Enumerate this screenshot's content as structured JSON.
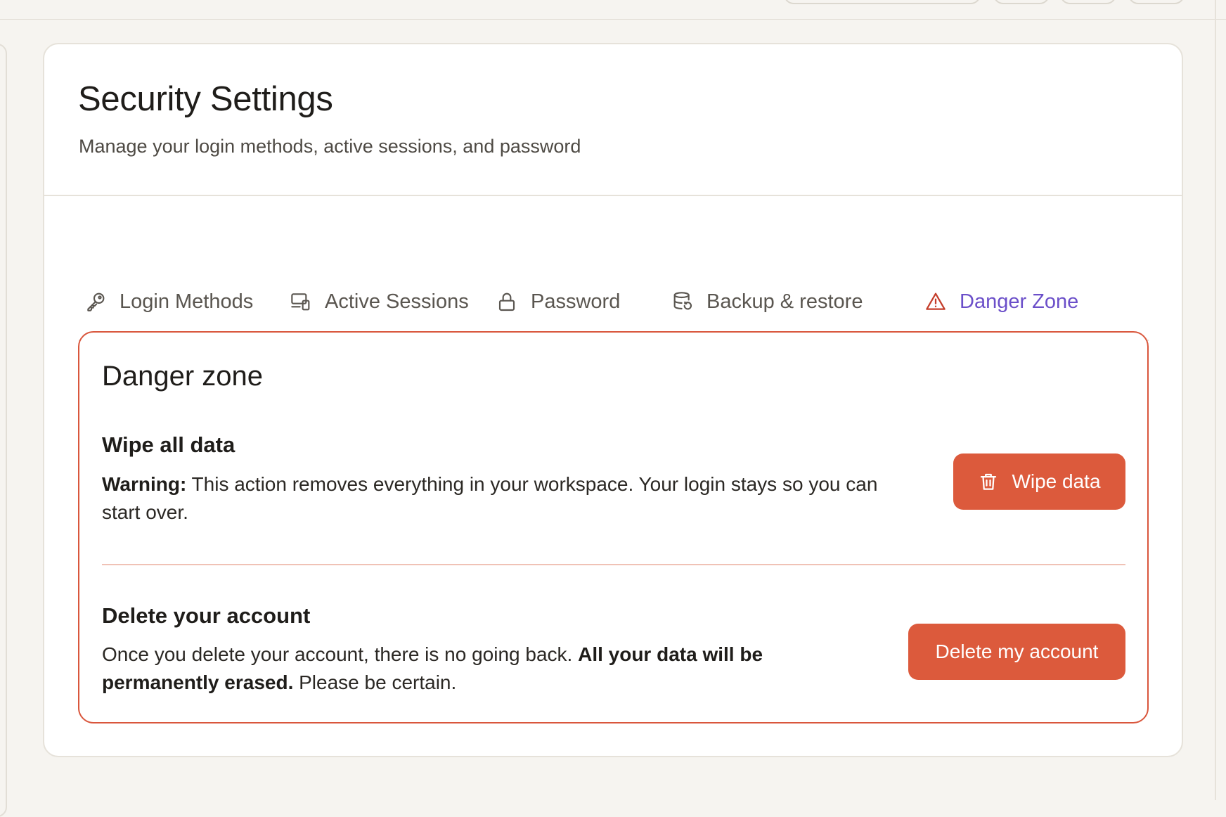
{
  "header": {
    "title": "Security Settings",
    "subtitle": "Manage your login methods, active sessions, and password"
  },
  "tabs": [
    {
      "label": "Login Methods",
      "icon": "key-icon",
      "active": false
    },
    {
      "label": "Active Sessions",
      "icon": "devices-icon",
      "active": false
    },
    {
      "label": "Password",
      "icon": "lock-icon",
      "active": false
    },
    {
      "label": "Backup & restore",
      "icon": "database-restore-icon",
      "active": false
    },
    {
      "label": "Danger Zone",
      "icon": "warning-triangle-icon",
      "active": true
    }
  ],
  "danger_zone": {
    "title": "Danger zone",
    "wipe": {
      "heading": "Wipe all data",
      "warning_label": "Warning:",
      "description": " This action removes everything in your workspace. Your login stays so you can start over.",
      "button_label": "Wipe data",
      "button_icon": "trash-icon"
    },
    "delete": {
      "heading": "Delete your account",
      "description_start": "Once you delete your account, there is no going back. ",
      "description_bold": "All your data will be permanently erased.",
      "description_end": " Please be certain.",
      "button_label": "Delete my account"
    }
  },
  "colors": {
    "accent": "#6b4fc9",
    "danger": "#dc5a3c",
    "danger_border": "#d9563c",
    "warning_icon": "#c43d2a"
  }
}
